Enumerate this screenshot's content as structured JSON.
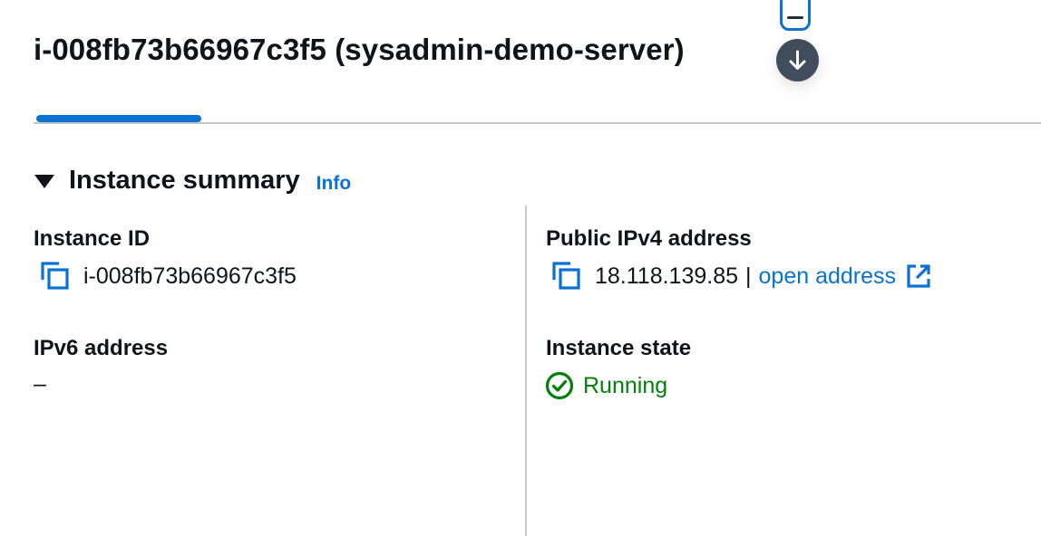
{
  "header": {
    "title": "i-008fb73b66967c3f5 (sysadmin-demo-server)"
  },
  "controls": {
    "minimize_icon": "minimize-icon",
    "download_icon": "arrow-down-icon"
  },
  "summary": {
    "section_title": "Instance summary",
    "info_label": "Info"
  },
  "fields": {
    "instance_id": {
      "label": "Instance ID",
      "value": "i-008fb73b66967c3f5"
    },
    "ipv6": {
      "label": "IPv6 address",
      "value": "–"
    },
    "public_ipv4": {
      "label": "Public IPv4 address",
      "value": "18.118.139.85",
      "separator": "|",
      "link": "open address"
    },
    "instance_state": {
      "label": "Instance state",
      "value": "Running"
    }
  },
  "colors": {
    "accent": "#0972d3",
    "success": "#037f0c",
    "text": "#0f141a",
    "divider": "#c6c6cd"
  }
}
